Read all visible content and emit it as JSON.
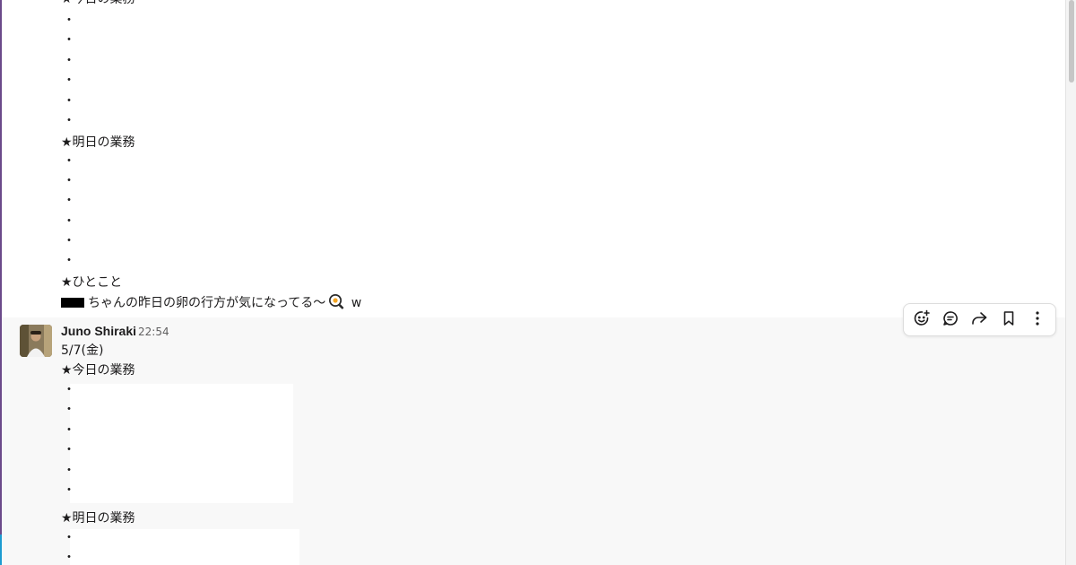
{
  "message_prev": {
    "today_heading": "★今日の業務",
    "today_bullets": [
      "・",
      "・",
      "・",
      "・",
      "・",
      "・"
    ],
    "tomorrow_heading": "★明日の業務",
    "tomorrow_bullets": [
      "・",
      "・",
      "・",
      "・",
      "・",
      "・"
    ],
    "comment_heading": "★ひとこと",
    "comment_text": "ちゃんの昨日の卵の行方が気になってる〜",
    "comment_suffix": "w"
  },
  "message_current": {
    "author": "Juno Shiraki",
    "time": "22:54",
    "date_line": "5/7(金)",
    "today_heading": "★今日の業務",
    "today_bullets": [
      "・",
      "・",
      "・",
      "・",
      "・",
      "・"
    ],
    "tomorrow_heading": "★明日の業務",
    "tomorrow_bullets": [
      "・",
      "・"
    ]
  },
  "toolbar": {
    "actions": [
      {
        "icon": "add-reaction-icon"
      },
      {
        "icon": "reply-thread-icon"
      },
      {
        "icon": "share-arrow-icon"
      },
      {
        "icon": "bookmark-icon"
      },
      {
        "icon": "more-vertical-icon"
      }
    ]
  },
  "colors": {
    "hover_background": "#f8f8f8",
    "text": "#1d1c1d",
    "timestamp": "#616061",
    "left_accent": "#6b4a8a"
  }
}
